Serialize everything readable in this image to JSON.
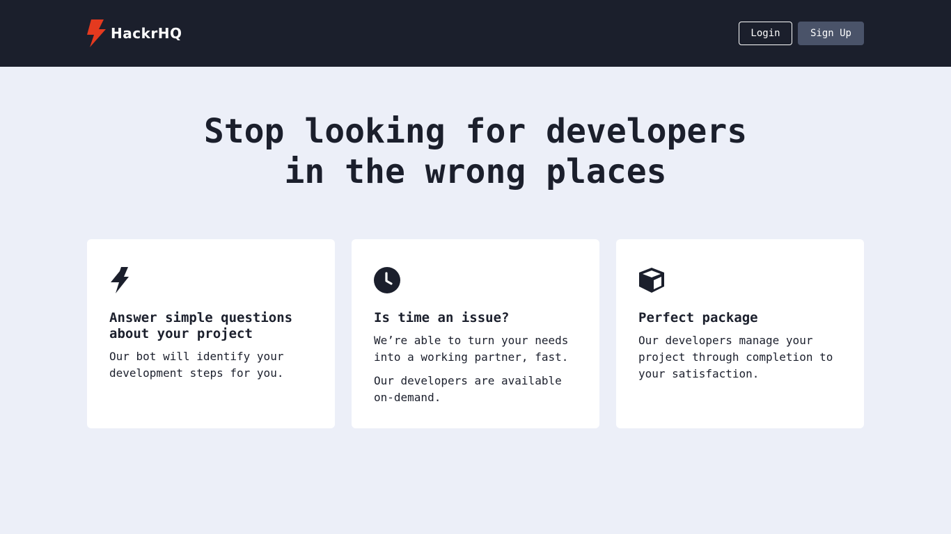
{
  "header": {
    "brand_name": "HackrHQ",
    "login_label": "Login",
    "signup_label": "Sign Up"
  },
  "hero": {
    "line1": "Stop looking for developers",
    "line2": "in the wrong places"
  },
  "features": [
    {
      "icon": "lightning-bolt-icon",
      "title": "Answer simple questions about your project",
      "paragraphs": [
        "Our bot will identify your development steps for you."
      ]
    },
    {
      "icon": "clock-icon",
      "title": "Is time an issue?",
      "paragraphs": [
        "We’re able to turn your needs into a working partner, fast.",
        "Our developers are available on-demand."
      ]
    },
    {
      "icon": "package-icon",
      "title": "Perfect package",
      "paragraphs": [
        "Our developers manage your project through completion to your satisfaction."
      ]
    }
  ],
  "colors": {
    "nav_bg": "#1b1f2c",
    "page_bg": "#eceff8",
    "logo_red": "#e43a1f",
    "signup_bg": "#4a5369"
  }
}
